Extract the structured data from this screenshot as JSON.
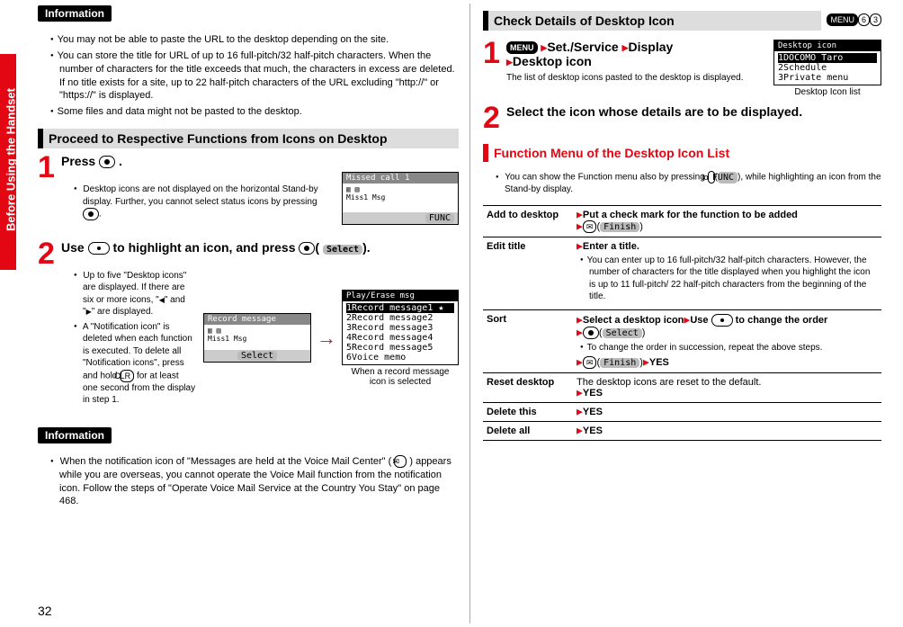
{
  "side_tab": "Before Using the Handset",
  "page_number": "32",
  "left": {
    "info1_label": "Information",
    "info1_items": [
      "You may not be able to paste the URL to the desktop depending on the site.",
      "You can store the title for URL of up to 16 full-pitch/32 half-pitch characters. When the number of characters for the title exceeds that much, the characters in excess are deleted. If no title exists for a site, up to 22 half-pitch characters of the URL excluding \"http://\" or \"https://\" is displayed.",
      "Some files and data might not be pasted to the desktop."
    ],
    "section1": "Proceed to Respective Functions from Icons on Desktop",
    "step1": {
      "title_prefix": "Press ",
      "title_suffix": ".",
      "bullets": [
        "Desktop icons are not displayed on the horizontal Stand-by display. Further, you cannot select status icons by pressing "
      ],
      "screen_title": "Missed call 1",
      "screen_func": "FUNC"
    },
    "step2": {
      "title_prefix": "Use ",
      "title_mid": " to highlight an icon, and press ",
      "title_label": "Select",
      "title_suffix": ").",
      "bullets": [
        "Up to five \"Desktop icons\" are displayed. If there are six or more icons, \"  \" and \"  \" are displayed.",
        "A \"Notification icon\" is deleted when each function is executed. To delete all \"Notification icons\", press and hold  for at least one second from the display in step 1."
      ],
      "clr_label": "CLR",
      "screen_a_title": "Record message",
      "screen_a_select": "Select",
      "screen_b_title": "Play/Erase msg",
      "screen_b_items": [
        "Record message1",
        "Record message2",
        "Record message3",
        "Record message4",
        "Record message5",
        "Voice memo"
      ],
      "screen_b_caption": "When a record message icon is selected"
    },
    "info2_label": "Information",
    "info2_items": [
      "When the notification icon of \"Messages are held at the Voice Mail Center\" (   ) appears while you are overseas, you cannot operate the Voice Mail function from the notification icon. Follow the steps of \"Operate Voice Mail Service at the Country You Stay\" on page 468."
    ]
  },
  "right": {
    "section_title": "Check Details of Desktop Icon",
    "chips": {
      "menu": "MENU",
      "n1": "6",
      "n2": "3"
    },
    "step1": {
      "chip": "MENU",
      "path": [
        "Set./Service",
        "Display",
        "Desktop icon"
      ],
      "desc": "The list of desktop icons pasted to the desktop is displayed.",
      "screen_title": "Desktop icon",
      "screen_items": [
        "DOCOMO Taro",
        "Schedule",
        "Private menu"
      ],
      "caption": "Desktop Icon list"
    },
    "step2": {
      "title": "Select the icon whose details are to be displayed."
    },
    "func_title": "Function Menu of the Desktop Icon List",
    "func_intro_pre": "You can show the Function menu also by pressing ",
    "func_intro_label": "FUNC",
    "func_intro_post": "), while highlighting an icon from the Stand-by display.",
    "rows": {
      "add": {
        "name": "Add to desktop",
        "desc_pre": "Put a check mark for the function to be added",
        "label": "Finish"
      },
      "edit": {
        "name": "Edit title",
        "desc": "Enter a title.",
        "bullets": [
          "You can enter up to 16 full-pitch/32 half-pitch characters. However, the number of characters for the title displayed when you highlight the icon is up to 11 full-pitch/ 22 half-pitch characters from the beginning of the title."
        ]
      },
      "sort": {
        "name": "Sort",
        "desc_pre": "Select a desktop icon",
        "desc_mid": "Use ",
        "desc_post": " to change the order",
        "label1": "Select",
        "bullet": "To change the order in succession, repeat the above steps.",
        "label2": "Finish",
        "yes": "YES"
      },
      "reset": {
        "name": "Reset desktop",
        "desc": "The desktop icons are reset to the default.",
        "yes": "YES"
      },
      "delthis": {
        "name": "Delete this",
        "yes": "YES"
      },
      "delall": {
        "name": "Delete all",
        "yes": "YES"
      }
    }
  }
}
